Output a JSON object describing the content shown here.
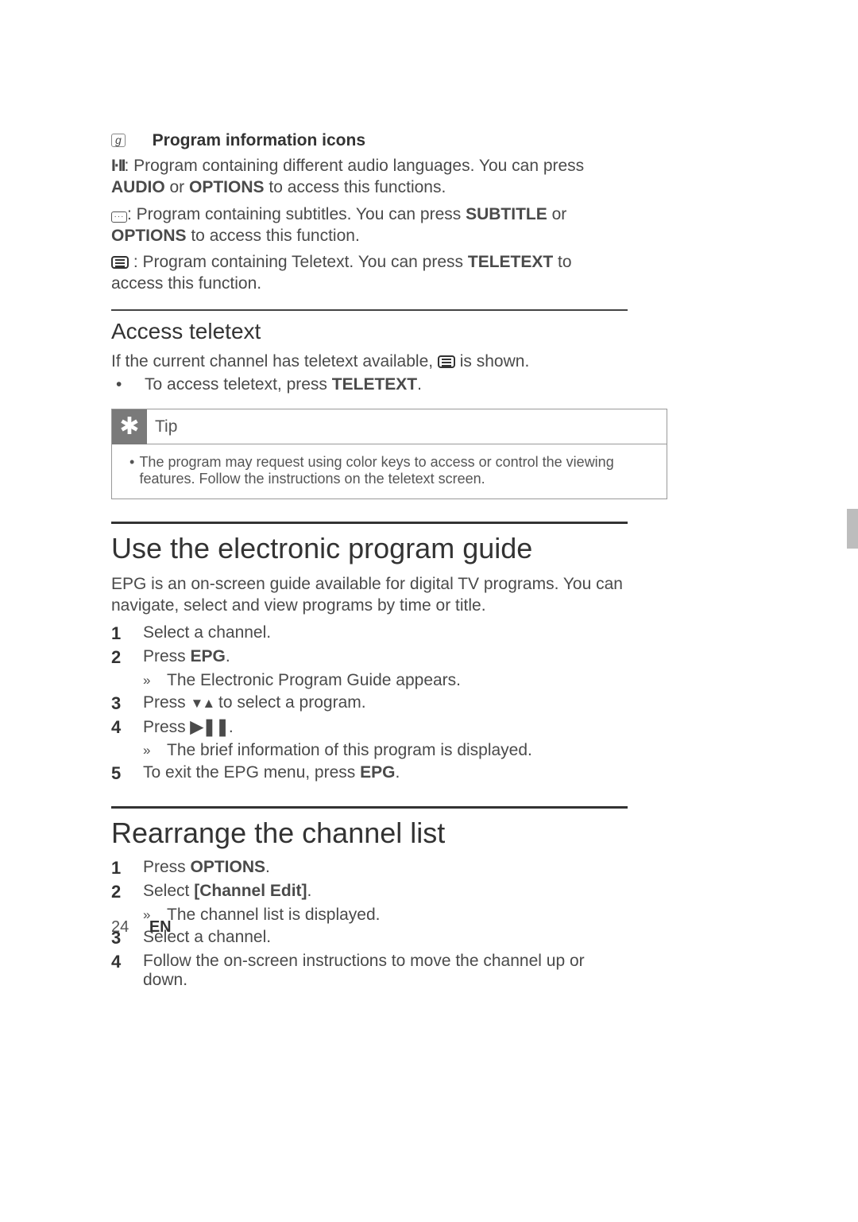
{
  "section_g": {
    "marker": "g",
    "heading": "Program information icons",
    "audio": {
      "icon_label": "I·II",
      "text_before": ": Program containing different audio languages. You can press ",
      "btn1": "AUDIO",
      "or": " or ",
      "btn2": "OPTIONS",
      "text_after": " to access this functions."
    },
    "subtitle": {
      "icon_inner": "···",
      "text_before": ": Program containing subtitles. You can press ",
      "btn1": "SUBTITLE",
      "or": " or ",
      "btn2": "OPTIONS",
      "text_after": " to access this function."
    },
    "teletext": {
      "text_before": " : Program containing Teletext. You can press ",
      "btn1": "TELETEXT",
      "text_after": " to access this function."
    }
  },
  "access_teletext": {
    "heading": "Access teletext",
    "line1_a": "If the current channel has teletext available, ",
    "line1_b": " is shown.",
    "bullet_a": "To access teletext, press ",
    "bullet_b": "TELETEXT",
    "bullet_c": "."
  },
  "tip": {
    "label": "Tip",
    "text": "The program may request using color keys to access or control the viewing features. Follow the instructions on the teletext screen."
  },
  "epg": {
    "heading": "Use the electronic program guide",
    "intro": "EPG is an on-screen guide available for digital TV programs. You can navigate, select and view programs by time or title.",
    "steps": {
      "s1": "Select a channel.",
      "s2a": "Press ",
      "s2b": "EPG",
      "s2c": ".",
      "s2_sub": "The Electronic Program Guide appears.",
      "s3a": "Press ",
      "s3_icons": "▼▲",
      "s3b": " to select a program.",
      "s4a": "Press ",
      "s4_icons": "▶❚❚",
      "s4b": ".",
      "s4_sub": "The brief information of this program is displayed.",
      "s5a": "To exit the EPG menu, press ",
      "s5b": "EPG",
      "s5c": "."
    }
  },
  "rearrange": {
    "heading": "Rearrange the channel list",
    "s1a": "Press ",
    "s1b": "OPTIONS",
    "s1c": ".",
    "s2a": "Select ",
    "s2b": "[Channel Edit]",
    "s2c": ".",
    "s2_sub": "The channel list is displayed.",
    "s3": "Select a channel.",
    "s4": "Follow the on-screen instructions to move the channel up or down."
  },
  "footer": {
    "page": "24",
    "lang": "EN"
  }
}
